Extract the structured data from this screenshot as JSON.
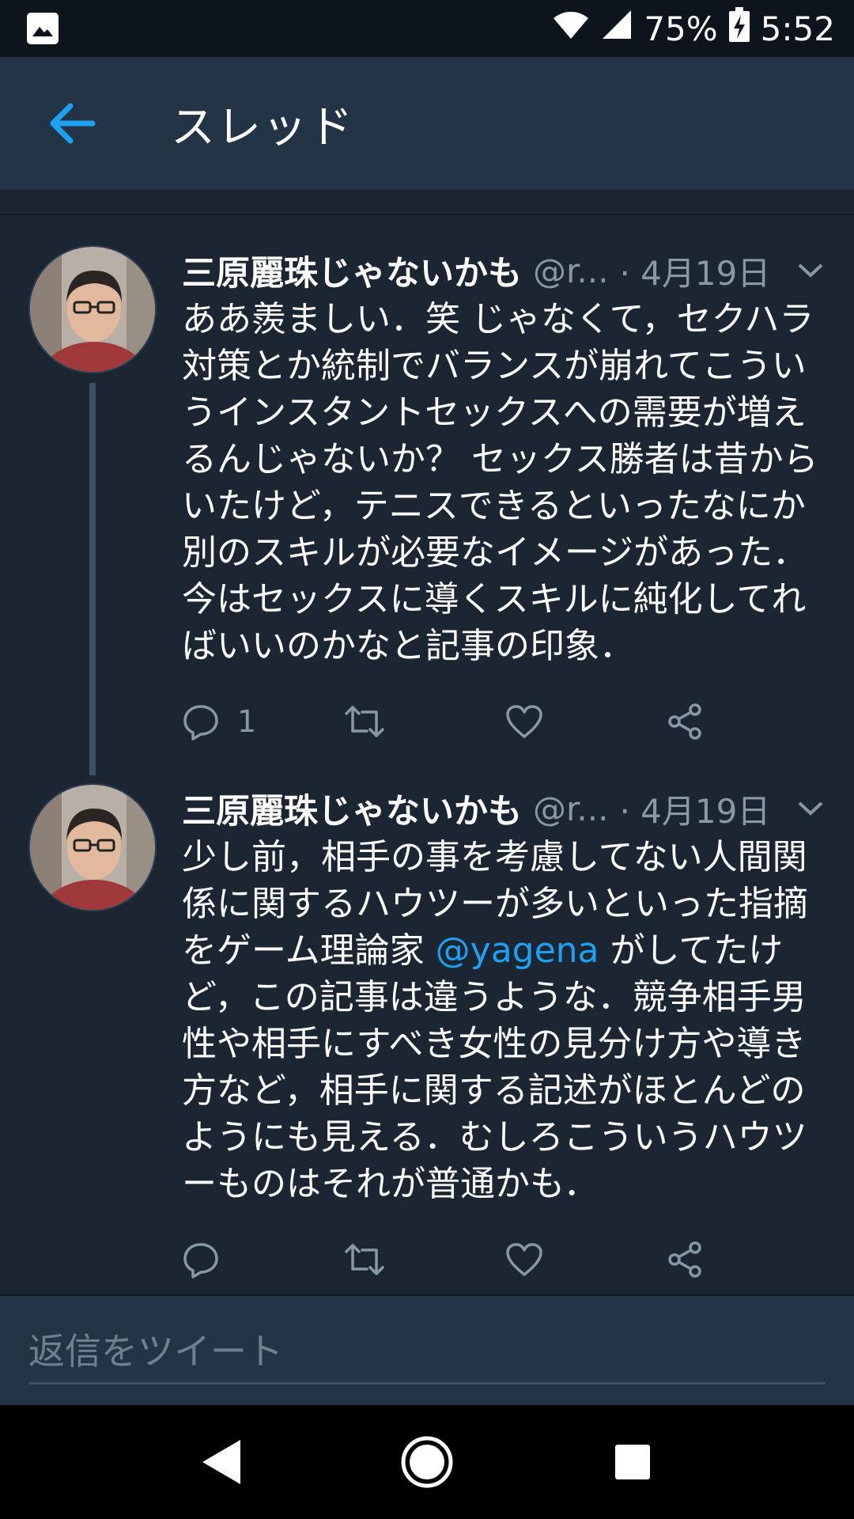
{
  "status_bar": {
    "battery": "75%",
    "time": "5:52",
    "icons": [
      "gallery-icon",
      "wifi-icon",
      "signal-icon",
      "battery-charging-icon"
    ]
  },
  "header": {
    "title": "スレッド",
    "back_icon": "arrow-left-icon",
    "accent_color": "#1da1f2"
  },
  "tweets": [
    {
      "author": "三原麗珠じゃないかも",
      "handle": "@r...",
      "date": "· 4月19日",
      "text": "ああ羨ましい．笑 じゃなくて，セクハラ対策とか統制でバランスが崩れてこういうインスタントセックスへの需要が増えるんじゃないか？ セックス勝者は昔からいたけど，テニスできるといったなにか別のスキルが必要なイメージがあった．今はセックスに導くスキルに純化してればいいのかなと記事の印象．",
      "reply_count": "1"
    },
    {
      "author": "三原麗珠じゃないかも",
      "handle": "@r...",
      "date": "· 4月19日",
      "text_before": "少し前，相手の事を考慮してない人間関係に関するハウツーが多いといった指摘をゲーム理論家 ",
      "mention": "@yagena",
      "text_after": " がしてたけど，この記事は違うような．競争相手男性や相手にすべき女性の見分け方や導き方など，相手に関する記述がほとんどのようにも見える．むしろこういうハウツーものはそれが普通かも．"
    }
  ],
  "reply_box": {
    "placeholder": "返信をツイート"
  },
  "nav_bar": {
    "icons": [
      "back-triangle-icon",
      "home-circle-icon",
      "recents-square-icon"
    ]
  }
}
